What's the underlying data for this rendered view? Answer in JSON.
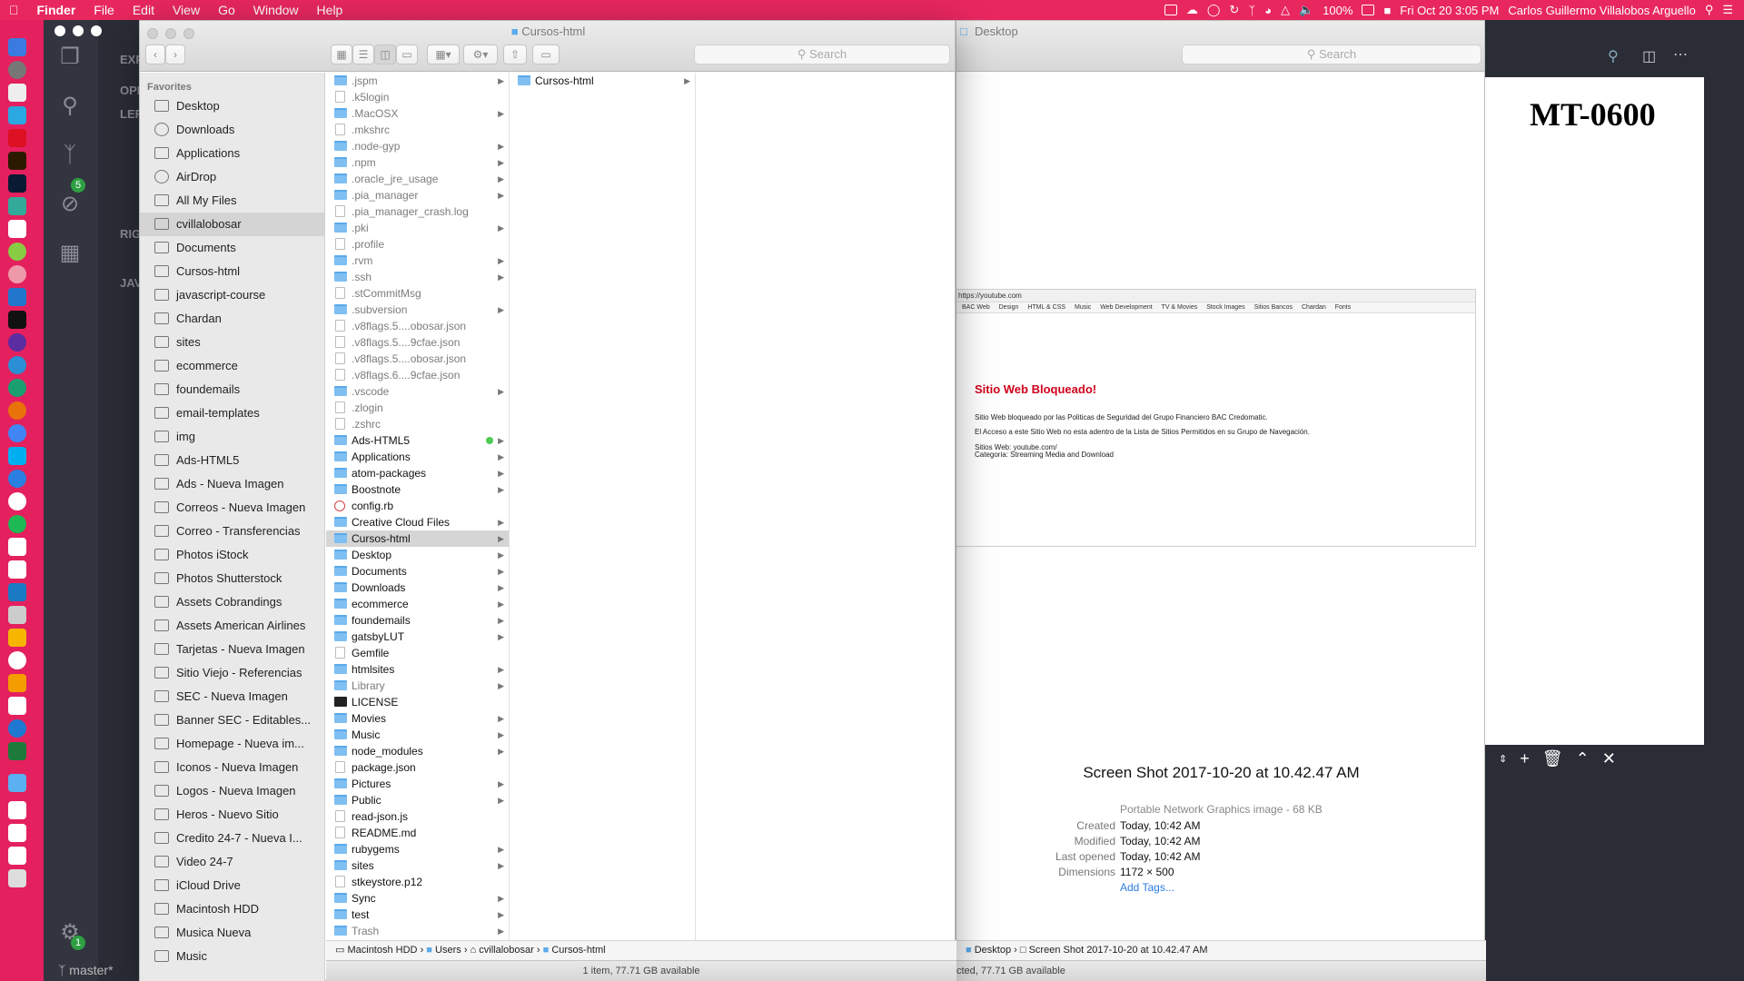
{
  "menubar": {
    "app": "Finder",
    "items": [
      "File",
      "Edit",
      "View",
      "Go",
      "Window",
      "Help"
    ],
    "battery": "100%",
    "clock": "Fri Oct 20  3:05 PM",
    "user": "Carlos Guillermo Villalobos Arguello"
  },
  "editor": {
    "side_labels": [
      "EXP",
      "OPE",
      "LEF",
      "RIG",
      "JAV"
    ],
    "preview_heading": "MT-0600",
    "git_badge": "5",
    "settings_badge": "1",
    "branch": "master*"
  },
  "finder": {
    "title": "Cursos-html",
    "search_placeholder": "Search",
    "sidebar_header": "Favorites",
    "sidebar": [
      {
        "label": "Desktop",
        "selected": false
      },
      {
        "label": "Downloads",
        "selected": false
      },
      {
        "label": "Applications",
        "selected": false
      },
      {
        "label": "AirDrop",
        "selected": false
      },
      {
        "label": "All My Files",
        "selected": false
      },
      {
        "label": "cvillalobosar",
        "selected": true
      },
      {
        "label": "Documents",
        "selected": false
      },
      {
        "label": "Cursos-html",
        "selected": false
      },
      {
        "label": "javascript-course",
        "selected": false
      },
      {
        "label": "Chardan",
        "selected": false
      },
      {
        "label": "sites",
        "selected": false
      },
      {
        "label": "ecommerce",
        "selected": false
      },
      {
        "label": "foundemails",
        "selected": false
      },
      {
        "label": "email-templates",
        "selected": false
      },
      {
        "label": "img",
        "selected": false
      },
      {
        "label": "Ads-HTML5",
        "selected": false
      },
      {
        "label": "Ads - Nueva Imagen",
        "selected": false
      },
      {
        "label": "Correos - Nueva Imagen",
        "selected": false
      },
      {
        "label": "Correo - Transferencias",
        "selected": false
      },
      {
        "label": "Photos iStock",
        "selected": false
      },
      {
        "label": "Photos Shutterstock",
        "selected": false
      },
      {
        "label": "Assets Cobrandings",
        "selected": false
      },
      {
        "label": "Assets American Airlines",
        "selected": false
      },
      {
        "label": "Tarjetas - Nueva Imagen",
        "selected": false
      },
      {
        "label": "Sitio Viejo - Referencias",
        "selected": false
      },
      {
        "label": "SEC - Nueva Imagen",
        "selected": false
      },
      {
        "label": "Banner SEC - Editables...",
        "selected": false
      },
      {
        "label": "Homepage - Nueva im...",
        "selected": false
      },
      {
        "label": "Iconos - Nueva Imagen",
        "selected": false
      },
      {
        "label": "Logos - Nueva Imagen",
        "selected": false
      },
      {
        "label": "Heros - Nuevo Sitio",
        "selected": false
      },
      {
        "label": "Credito 24-7 - Nueva I...",
        "selected": false
      },
      {
        "label": "Video 24-7",
        "selected": false
      },
      {
        "label": "iCloud Drive",
        "selected": false
      },
      {
        "label": "Macintosh HDD",
        "selected": false
      },
      {
        "label": "Musica Nueva",
        "selected": false
      },
      {
        "label": "Music",
        "selected": false
      }
    ],
    "column1": [
      {
        "name": ".jspm",
        "kind": "folder",
        "hidden": true,
        "arrow": true
      },
      {
        "name": ".k5login",
        "kind": "file",
        "hidden": true,
        "arrow": false
      },
      {
        "name": ".MacOSX",
        "kind": "folder",
        "hidden": true,
        "arrow": true
      },
      {
        "name": ".mkshrc",
        "kind": "file",
        "hidden": true,
        "arrow": false
      },
      {
        "name": ".node-gyp",
        "kind": "folder",
        "hidden": true,
        "arrow": true
      },
      {
        "name": ".npm",
        "kind": "folder",
        "hidden": true,
        "arrow": true
      },
      {
        "name": ".oracle_jre_usage",
        "kind": "folder",
        "hidden": true,
        "arrow": true
      },
      {
        "name": ".pia_manager",
        "kind": "folder",
        "hidden": true,
        "arrow": true
      },
      {
        "name": ".pia_manager_crash.log",
        "kind": "file",
        "hidden": true,
        "arrow": false
      },
      {
        "name": ".pki",
        "kind": "folder",
        "hidden": true,
        "arrow": true
      },
      {
        "name": ".profile",
        "kind": "file",
        "hidden": true,
        "arrow": false
      },
      {
        "name": ".rvm",
        "kind": "folder",
        "hidden": true,
        "arrow": true
      },
      {
        "name": ".ssh",
        "kind": "folder",
        "hidden": true,
        "arrow": true
      },
      {
        "name": ".stCommitMsg",
        "kind": "file",
        "hidden": true,
        "arrow": false
      },
      {
        "name": ".subversion",
        "kind": "folder",
        "hidden": true,
        "arrow": true
      },
      {
        "name": ".v8flags.5....obosar.json",
        "kind": "file",
        "hidden": true,
        "arrow": false
      },
      {
        "name": ".v8flags.5....9cfae.json",
        "kind": "file",
        "hidden": true,
        "arrow": false
      },
      {
        "name": ".v8flags.5....obosar.json",
        "kind": "file",
        "hidden": true,
        "arrow": false
      },
      {
        "name": ".v8flags.6....9cfae.json",
        "kind": "file",
        "hidden": true,
        "arrow": false
      },
      {
        "name": ".vscode",
        "kind": "folder",
        "hidden": true,
        "arrow": true
      },
      {
        "name": ".zlogin",
        "kind": "file",
        "hidden": true,
        "arrow": false
      },
      {
        "name": ".zshrc",
        "kind": "file",
        "hidden": true,
        "arrow": false
      },
      {
        "name": "Ads-HTML5",
        "kind": "folder",
        "hidden": false,
        "arrow": true,
        "dot": true
      },
      {
        "name": "Applications",
        "kind": "folder",
        "hidden": false,
        "arrow": true
      },
      {
        "name": "atom-packages",
        "kind": "folder",
        "hidden": false,
        "arrow": true
      },
      {
        "name": "Boostnote",
        "kind": "folder",
        "hidden": false,
        "arrow": true
      },
      {
        "name": "config.rb",
        "kind": "red",
        "hidden": false,
        "arrow": false
      },
      {
        "name": "Creative Cloud Files",
        "kind": "folder",
        "hidden": false,
        "arrow": true
      },
      {
        "name": "Cursos-html",
        "kind": "folder",
        "hidden": false,
        "arrow": true,
        "selected": true
      },
      {
        "name": "Desktop",
        "kind": "folder",
        "hidden": false,
        "arrow": true
      },
      {
        "name": "Documents",
        "kind": "folder",
        "hidden": false,
        "arrow": true
      },
      {
        "name": "Downloads",
        "kind": "folder",
        "hidden": false,
        "arrow": true
      },
      {
        "name": "ecommerce",
        "kind": "folder",
        "hidden": false,
        "arrow": true
      },
      {
        "name": "foundemails",
        "kind": "folder",
        "hidden": false,
        "arrow": true
      },
      {
        "name": "gatsbyLUT",
        "kind": "folder",
        "hidden": false,
        "arrow": true
      },
      {
        "name": "Gemfile",
        "kind": "file",
        "hidden": false,
        "arrow": false
      },
      {
        "name": "htmlsites",
        "kind": "folder",
        "hidden": false,
        "arrow": true
      },
      {
        "name": "Library",
        "kind": "folder",
        "hidden": true,
        "arrow": true
      },
      {
        "name": "LICENSE",
        "kind": "dark",
        "hidden": false,
        "arrow": false
      },
      {
        "name": "Movies",
        "kind": "folder",
        "hidden": false,
        "arrow": true
      },
      {
        "name": "Music",
        "kind": "folder",
        "hidden": false,
        "arrow": true
      },
      {
        "name": "node_modules",
        "kind": "folder",
        "hidden": false,
        "arrow": true
      },
      {
        "name": "package.json",
        "kind": "file",
        "hidden": false,
        "arrow": false
      },
      {
        "name": "Pictures",
        "kind": "folder",
        "hidden": false,
        "arrow": true
      },
      {
        "name": "Public",
        "kind": "folder",
        "hidden": false,
        "arrow": true
      },
      {
        "name": "read-json.js",
        "kind": "file",
        "hidden": false,
        "arrow": false
      },
      {
        "name": "README.md",
        "kind": "file",
        "hidden": false,
        "arrow": false
      },
      {
        "name": "rubygems",
        "kind": "folder",
        "hidden": false,
        "arrow": true
      },
      {
        "name": "sites",
        "kind": "folder",
        "hidden": false,
        "arrow": true
      },
      {
        "name": "stkeystore.p12",
        "kind": "file",
        "hidden": false,
        "arrow": false
      },
      {
        "name": "Sync",
        "kind": "folder",
        "hidden": false,
        "arrow": true
      },
      {
        "name": "test",
        "kind": "folder",
        "hidden": false,
        "arrow": true
      },
      {
        "name": "Trash",
        "kind": "folder",
        "hidden": true,
        "arrow": true
      }
    ],
    "column2": [
      {
        "name": "Cursos-html",
        "kind": "folder",
        "hidden": false,
        "arrow": true
      }
    ],
    "path": [
      "Macintosh HDD",
      "Users",
      "cvillalobosar",
      "Cursos-html"
    ],
    "status": "1 item, 77.71 GB available"
  },
  "desktop_window": {
    "title": "Desktop",
    "search_placeholder": "Search",
    "screenshot": {
      "url": "https://youtube.com",
      "bookmarks": [
        "BAC Web",
        "Design",
        "HTML & CSS",
        "Music",
        "Web Development",
        "TV & Movies",
        "Stock Images",
        "Sitios Bancos",
        "Chardan",
        "Fonts"
      ],
      "heading": "Sitio Web Bloqueado!",
      "line1": "Sitio Web bloqueado por las Politicas de Seguridad del Grupo Financiero BAC Credomatic.",
      "line2": "El Acceso a este Sitio Web no esta adentro de la Lista de Sitios Permitidos en su Grupo de Navegación.",
      "line3": "Sitios Web: youtube.com/",
      "line4": "Categoria: Streaming Media and Download"
    },
    "file_name": "Screen Shot 2017-10-20 at 10.42.47 AM",
    "kind": "Portable Network Graphics image - 68 KB",
    "meta": [
      {
        "k": "Created",
        "v": "Today, 10:42 AM"
      },
      {
        "k": "Modified",
        "v": "Today, 10:42 AM"
      },
      {
        "k": "Last opened",
        "v": "Today, 10:42 AM"
      },
      {
        "k": "Dimensions",
        "v": "1172 × 500"
      }
    ],
    "add_tags": "Add Tags...",
    "path": [
      "Desktop",
      "Screen Shot 2017-10-20 at 10.42.47 AM"
    ],
    "status": "cted, 77.71 GB available"
  },
  "colors": {
    "accent": "#e8275f",
    "folder": "#7fbff2",
    "link": "#2a7ae4",
    "blocked": "#d0021b"
  }
}
